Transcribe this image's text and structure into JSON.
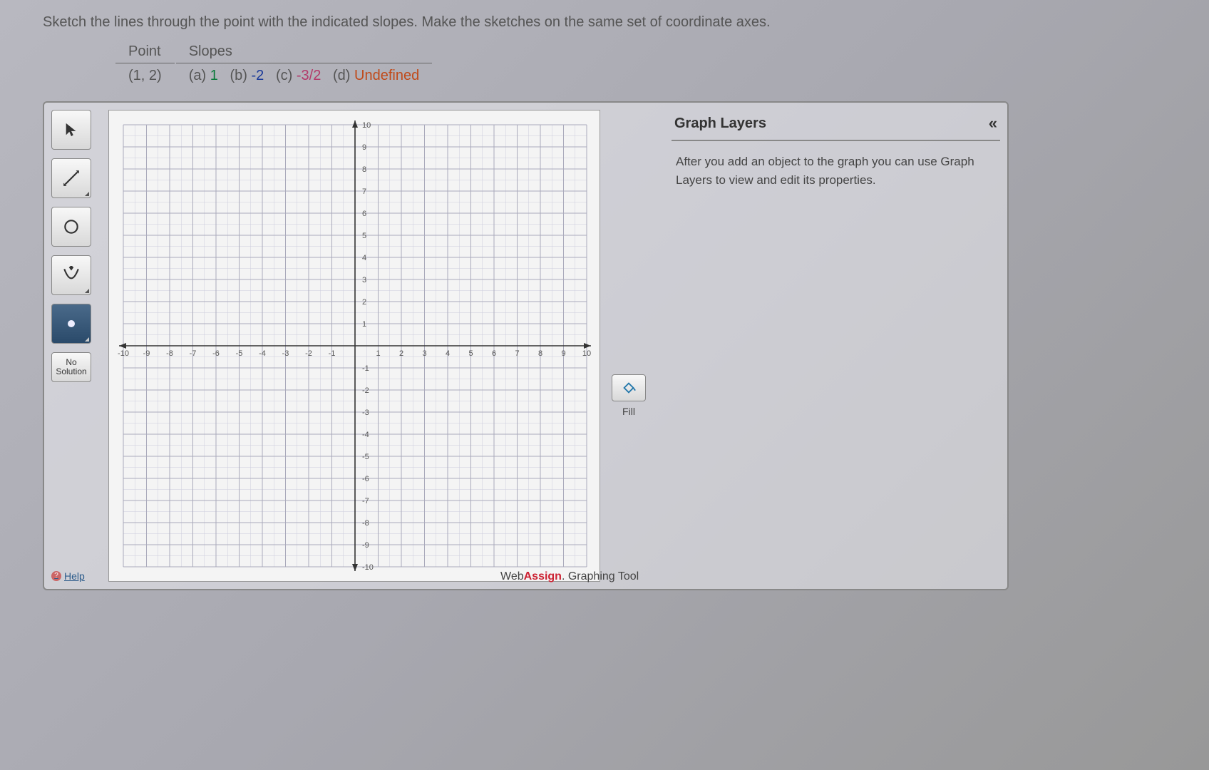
{
  "question": "Sketch the lines through the point with the indicated slopes. Make the sketches on the same set of coordinate axes.",
  "table": {
    "headers": [
      "Point",
      "Slopes"
    ],
    "point": "(1, 2)",
    "slopes": {
      "a_label": "(a)",
      "a_val": "1",
      "b_label": "(b)",
      "b_val": "-2",
      "c_label": "(c)",
      "c_val": "-3/2",
      "d_label": "(d)",
      "d_val": "Undefined"
    }
  },
  "toolbar": {
    "no_solution": "No\nSolution",
    "help": "Help"
  },
  "fill": {
    "label": "Fill"
  },
  "layers": {
    "title": "Graph Layers",
    "collapse_glyph": "«",
    "body": "After you add an object to the graph you can use Graph Layers to view and edit its properties."
  },
  "brand": {
    "prefix": "Web",
    "assign": "Assign",
    "suffix": ". Graphing Tool"
  },
  "chart_data": {
    "type": "scatter",
    "title": "",
    "xlabel": "",
    "ylabel": "",
    "xlim": [
      -10,
      10
    ],
    "ylim": [
      -10,
      10
    ],
    "xticks": [
      -10,
      -9,
      -8,
      -7,
      -6,
      -5,
      -4,
      -3,
      -2,
      -1,
      1,
      2,
      3,
      4,
      5,
      6,
      7,
      8,
      9,
      10
    ],
    "yticks": [
      -10,
      -9,
      -8,
      -7,
      -6,
      -5,
      -4,
      -3,
      -2,
      -1,
      1,
      2,
      3,
      4,
      5,
      6,
      7,
      8,
      9,
      10
    ],
    "series": []
  }
}
